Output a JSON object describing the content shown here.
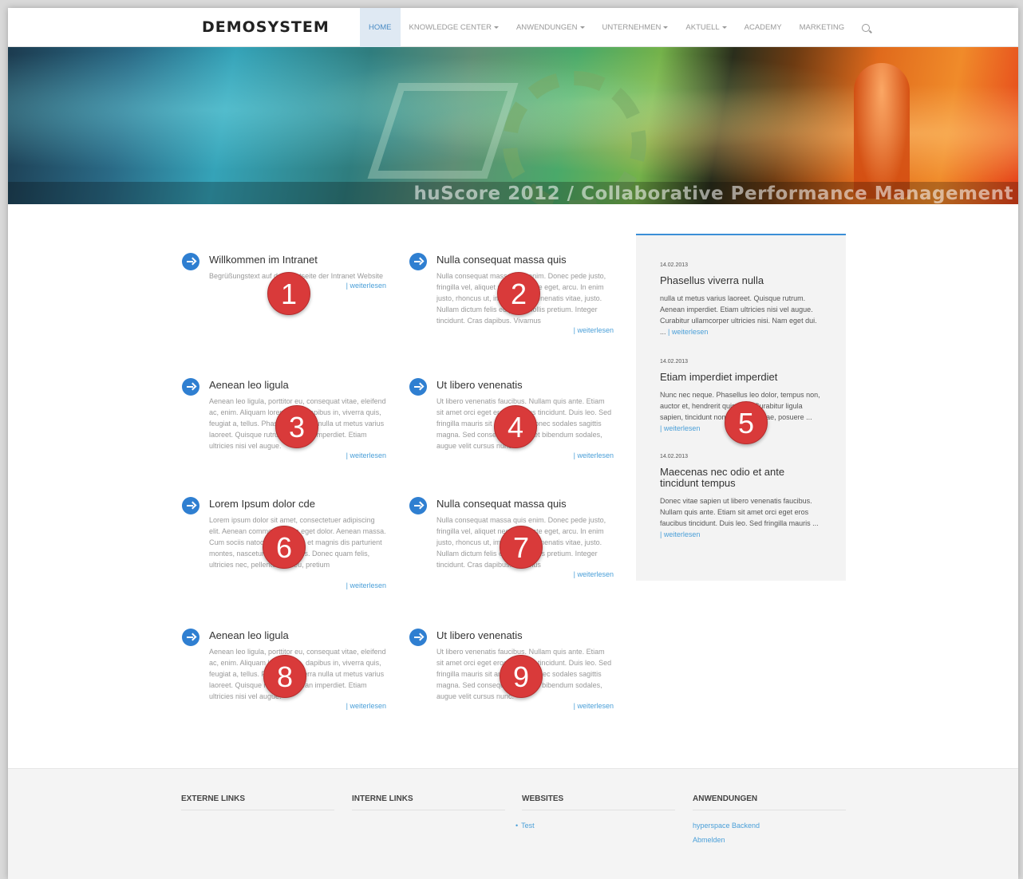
{
  "header": {
    "logo": "DEMOSYSTEM",
    "nav": [
      {
        "label": "HOME",
        "active": true,
        "dropdown": false
      },
      {
        "label": "KNOWLEDGE CENTER",
        "active": false,
        "dropdown": true
      },
      {
        "label": "ANWENDUNGEN",
        "active": false,
        "dropdown": true
      },
      {
        "label": "UNTERNEHMEN",
        "active": false,
        "dropdown": true
      },
      {
        "label": "AKTUELL",
        "active": false,
        "dropdown": true
      },
      {
        "label": "ACADEMY",
        "active": false,
        "dropdown": false
      },
      {
        "label": "MARKETING",
        "active": false,
        "dropdown": false
      }
    ],
    "search_icon": "search-icon"
  },
  "banner": {
    "caption": "huScore 2012 / Collaborative Performance Management"
  },
  "teasers": [
    {
      "title": "Willkommen im Intranet",
      "text": "Begrüßungstext auf der Startseite der Intranet Website",
      "more": "| weiterlesen",
      "badge": "1"
    },
    {
      "title": "Nulla consequat massa quis",
      "text": "Nulla consequat massa quis enim. Donec pede justo, fringilla vel, aliquet nec, vulputate eget, arcu. In enim justo, rhoncus ut, imperdiet a, venenatis vitae, justo. Nullam dictum felis eu pede mollis pretium. Integer tincidunt. Cras dapibus. Vivamus",
      "more": "| weiterlesen",
      "badge": "2"
    },
    {
      "title": "Aenean leo ligula",
      "text": "Aenean leo ligula, porttitor eu, consequat vitae, eleifend ac, enim. Aliquam lorem ante, dapibus in, viverra quis, feugiat a, tellus. Phasellus viverra nulla ut metus varius laoreet. Quisque rutrum. Aenean imperdiet. Etiam ultricies nisi vel augue.",
      "more": "| weiterlesen",
      "badge": "3"
    },
    {
      "title": "Ut libero venenatis",
      "text": "Ut libero venenatis faucibus. Nullam quis ante. Etiam sit amet orci eget eros faucibus tincidunt. Duis leo. Sed fringilla mauris sit amet nibh. Donec sodales sagittis magna. Sed consequat, leo eget bibendum sodales, augue velit cursus nunc.",
      "more": "| weiterlesen",
      "badge": "4"
    },
    {
      "title": "Lorem Ipsum dolor cde",
      "text": "Lorem ipsum dolor sit amet, consectetuer adipiscing elit. Aenean commodo ligula eget dolor. Aenean massa. Cum sociis natoque penatibus et magnis dis parturient montes, nascetur ridiculus mus. Donec quam felis, ultricies nec, pellentesque eu, pretium",
      "more": "| weiterlesen",
      "badge": "6"
    },
    {
      "title": "Nulla consequat massa quis",
      "text": "Nulla consequat massa quis enim. Donec pede justo, fringilla vel, aliquet nec, vulputate eget, arcu. In enim justo, rhoncus ut, imperdiet a, venenatis vitae, justo. Nullam dictum felis eu pede mollis pretium. Integer tincidunt. Cras dapibus. Vivamus",
      "more": "| weiterlesen",
      "badge": "7"
    },
    {
      "title": "Aenean leo ligula",
      "text": "Aenean leo ligula, porttitor eu, consequat vitae, eleifend ac, enim. Aliquam lorem ante, dapibus in, viverra quis, feugiat a, tellus. Phasellus viverra nulla ut metus varius laoreet. Quisque rutrum. Aenean imperdiet. Etiam ultricies nisi vel augue.",
      "more": "| weiterlesen",
      "badge": "8"
    },
    {
      "title": "Ut libero venenatis",
      "text": "Ut libero venenatis faucibus. Nullam quis ante. Etiam sit amet orci eget eros faucibus tincidunt. Duis leo. Sed fringilla mauris sit amet nibh. Donec sodales sagittis magna. Sed consequat, leo eget bibendum sodales, augue velit cursus nunc.",
      "more": "| weiterlesen",
      "badge": "9"
    }
  ],
  "news": {
    "badge": "5",
    "items": [
      {
        "date": "14.02.2013",
        "title": "Phasellus viverra nulla",
        "text": "nulla ut metus varius laoreet. Quisque rutrum. Aenean imperdiet. Etiam ultricies nisi vel augue. Curabitur ullamcorper ultricies nisi. Nam eget dui. ...",
        "more": "| weiterlesen"
      },
      {
        "date": "14.02.2013",
        "title": "Etiam imperdiet imperdiet",
        "text": "Nunc nec neque. Phasellus leo dolor, tempus non, auctor et, hendrerit quis, nisi. Curabitur ligula sapien, tincidunt non, euismod vitae, posuere ...",
        "more": "| weiterlesen"
      },
      {
        "date": "14.02.2013",
        "title": "Maecenas nec odio et ante tincidunt tempus",
        "text": "Donec vitae sapien ut libero venenatis faucibus. Nullam quis ante. Etiam sit amet orci eget eros faucibus tincidunt. Duis leo. Sed fringilla mauris ...",
        "more": "| weiterlesen"
      }
    ]
  },
  "footer": {
    "columns": [
      {
        "heading": "EXTERNE LINKS",
        "links": []
      },
      {
        "heading": "INTERNE LINKS",
        "links": []
      },
      {
        "heading": "WEBSITES",
        "links": [
          "Test"
        ]
      },
      {
        "heading": "ANWENDUNGEN",
        "links": [
          "hyperspace Backend",
          "Abmelden"
        ]
      }
    ]
  },
  "colors": {
    "accent": "#2f7fd1",
    "link": "#4a9fd8",
    "badge": "#d93a3a",
    "news_border": "#3b8fd6"
  }
}
